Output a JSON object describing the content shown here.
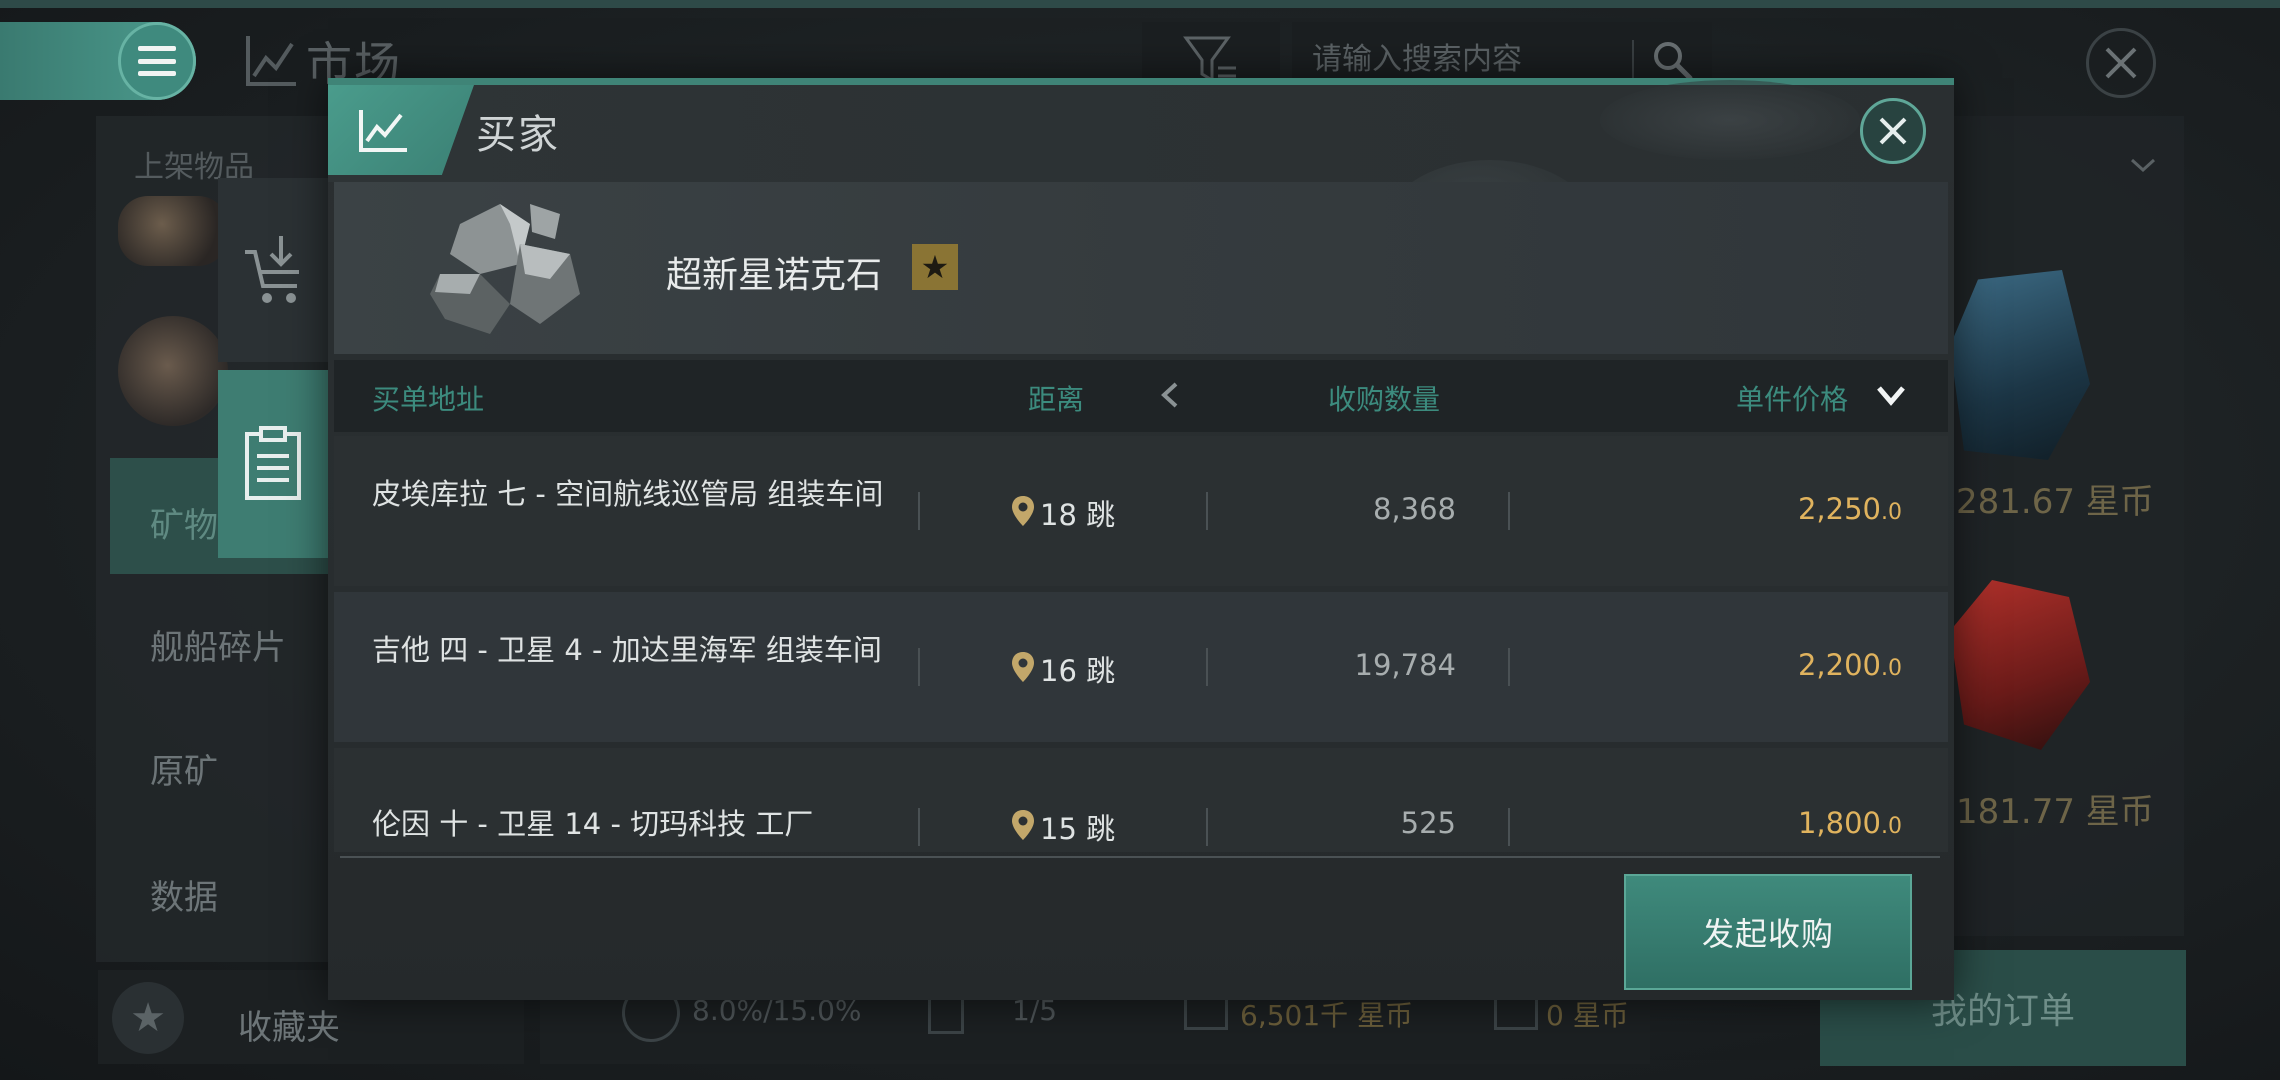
{
  "market": {
    "title": "市场",
    "search_placeholder": "请输入搜索内容",
    "listed_items_label": "上架物品",
    "categories": [
      "矿物",
      "舰船碎片",
      "原矿",
      "数据"
    ],
    "favorites_label": "收藏夹",
    "status": {
      "gauge": "8.0%/15.0%",
      "orders": "1/5",
      "balance": "6,501千 星币",
      "escrow": "0 星币"
    },
    "my_orders_label": "我的订单",
    "right_prices": [
      "281.67 星币",
      "181.77 星币"
    ]
  },
  "dialog": {
    "title": "买家",
    "item_name": "超新星诺克石",
    "item_star": "★",
    "columns": {
      "address": "买单地址",
      "distance": "距离",
      "quantity": "收购数量",
      "price": "单件价格"
    },
    "rows": [
      {
        "address": "皮埃库拉 七 - 空间航线巡管局 组装车间",
        "jumps": "18 跳",
        "quantity": "8,368",
        "price_main": "2,250",
        "price_dec": ".0"
      },
      {
        "address": "吉他 四 - 卫星 4 - 加达里海军 组装车间",
        "jumps": "16 跳",
        "quantity": "19,784",
        "price_main": "2,200",
        "price_dec": ".0"
      },
      {
        "address": "伦因 十 - 卫星 14 - 切玛科技 工厂",
        "jumps": "15 跳",
        "quantity": "525",
        "price_main": "1,800",
        "price_dec": ".0"
      }
    ],
    "submit_label": "发起收购"
  },
  "colors": {
    "accent": "#3f8a7c",
    "price": "#e0b35e",
    "header_text": "#3c8b7e"
  },
  "icons": [
    "menu-icon",
    "market-chart-icon",
    "filter-icon",
    "search-icon",
    "close-icon",
    "receive-icon",
    "orders-icon",
    "location-pin-icon",
    "sort-left-icon",
    "sort-down-icon",
    "star-icon"
  ]
}
